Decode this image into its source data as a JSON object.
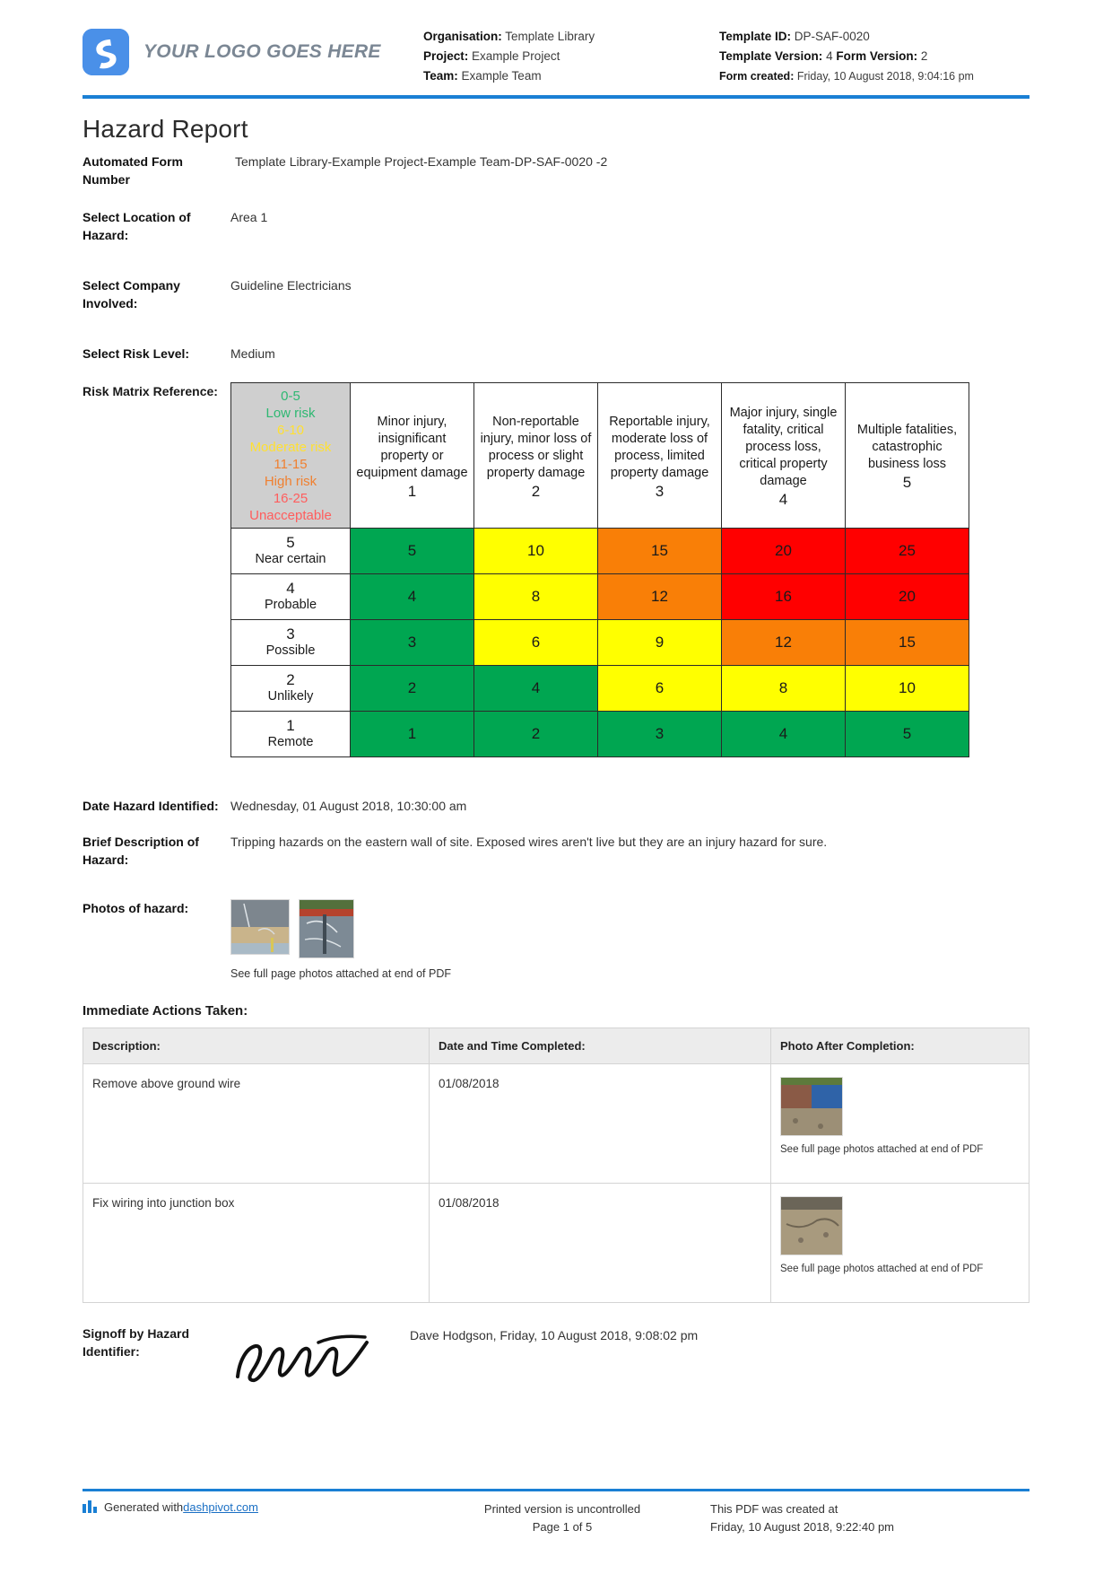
{
  "header": {
    "logo_text": "YOUR LOGO GOES HERE",
    "organisation_label": "Organisation:",
    "organisation_value": "Template Library",
    "project_label": "Project:",
    "project_value": "Example Project",
    "team_label": "Team:",
    "team_value": "Example Team",
    "template_id_label": "Template ID:",
    "template_id_value": "DP-SAF-0020",
    "template_version_label": "Template Version:",
    "template_version_value": "4",
    "form_version_label": "Form Version:",
    "form_version_value": "2",
    "form_created_label": "Form created:",
    "form_created_value": "Friday, 10 August 2018, 9:04:16 pm"
  },
  "title": "Hazard Report",
  "fields": {
    "form_number_label": "Automated Form Number",
    "form_number_value": "Template Library-Example Project-Example Team-DP-SAF-0020   -2",
    "location_label": "Select Location of Hazard:",
    "location_value": "Area 1",
    "company_label": "Select Company Involved:",
    "company_value": "Guideline Electricians",
    "risk_level_label": "Select Risk Level:",
    "risk_level_value": "Medium",
    "matrix_label": "Risk Matrix Reference:",
    "date_identified_label": "Date Hazard Identified:",
    "date_identified_value": "Wednesday, 01 August 2018, 10:30:00 am",
    "description_label": "Brief Description of Hazard:",
    "description_value": "Tripping hazards on the eastern wall of site. Exposed wires aren't live but they are an injury hazard for sure.",
    "photos_label": "Photos of hazard:",
    "photos_note": "See full page photos attached at end of PDF"
  },
  "chart_data": {
    "type": "heatmap",
    "title": "Risk Matrix Reference",
    "legend": [
      {
        "range": "0-5",
        "label": "Low risk",
        "color": "#2eb872"
      },
      {
        "range": "6-10",
        "label": "Moderate risk",
        "color": "#ffe033"
      },
      {
        "range": "11-15",
        "label": "High risk",
        "color": "#f08030"
      },
      {
        "range": "16-25",
        "label": "Unacceptable",
        "color": "#ff5d5d"
      }
    ],
    "columns": [
      {
        "num": "1",
        "text": "Minor injury, insignificant property or equipment damage"
      },
      {
        "num": "2",
        "text": "Non-reportable injury, minor loss of process or slight property damage"
      },
      {
        "num": "3",
        "text": "Reportable injury, moderate loss of process, limited property damage"
      },
      {
        "num": "4",
        "text": "Major injury, single fatality, critical process loss, critical property damage"
      },
      {
        "num": "5",
        "text": "Multiple fatalities, catastrophic business loss"
      }
    ],
    "rows": [
      {
        "num": "5",
        "text": "Near certain",
        "values": [
          5,
          10,
          15,
          20,
          25
        ],
        "colors": [
          "green",
          "yellow",
          "orange",
          "red",
          "red"
        ]
      },
      {
        "num": "4",
        "text": "Probable",
        "values": [
          4,
          8,
          12,
          16,
          20
        ],
        "colors": [
          "green",
          "yellow",
          "orange",
          "red",
          "red"
        ]
      },
      {
        "num": "3",
        "text": "Possible",
        "values": [
          3,
          6,
          9,
          12,
          15
        ],
        "colors": [
          "green",
          "yellow",
          "yellow",
          "orange",
          "orange"
        ]
      },
      {
        "num": "2",
        "text": "Unlikely",
        "values": [
          2,
          4,
          6,
          8,
          10
        ],
        "colors": [
          "green",
          "green",
          "yellow",
          "yellow",
          "yellow"
        ]
      },
      {
        "num": "1",
        "text": "Remote",
        "values": [
          1,
          2,
          3,
          4,
          5
        ],
        "colors": [
          "green",
          "green",
          "green",
          "green",
          "green"
        ]
      }
    ],
    "cell_colors": {
      "green": "#00A651",
      "yellow": "#FFFF00",
      "orange": "#F97F07",
      "red": "#FF0000"
    }
  },
  "actions": {
    "heading": "Immediate Actions Taken:",
    "columns": [
      "Description:",
      "Date and Time Completed:",
      "Photo After Completion:"
    ],
    "rows": [
      {
        "description": "Remove above ground wire",
        "date": "01/08/2018",
        "photo_note": "See full page photos attached at end of PDF"
      },
      {
        "description": "Fix wiring into junction box",
        "date": "01/08/2018",
        "photo_note": "See full page photos attached at end of PDF"
      }
    ]
  },
  "signoff": {
    "label": "Signoff by Hazard Identifier:",
    "value": "Dave Hodgson, Friday, 10 August 2018, 9:08:02 pm"
  },
  "footer": {
    "generated_prefix": "Generated with ",
    "generated_link": "dashpivot.com",
    "uncontrolled": "Printed version is uncontrolled",
    "page": "Page 1 of 5",
    "created_at": "This PDF was created at",
    "created_date": "Friday, 10 August 2018, 9:22:40 pm"
  }
}
